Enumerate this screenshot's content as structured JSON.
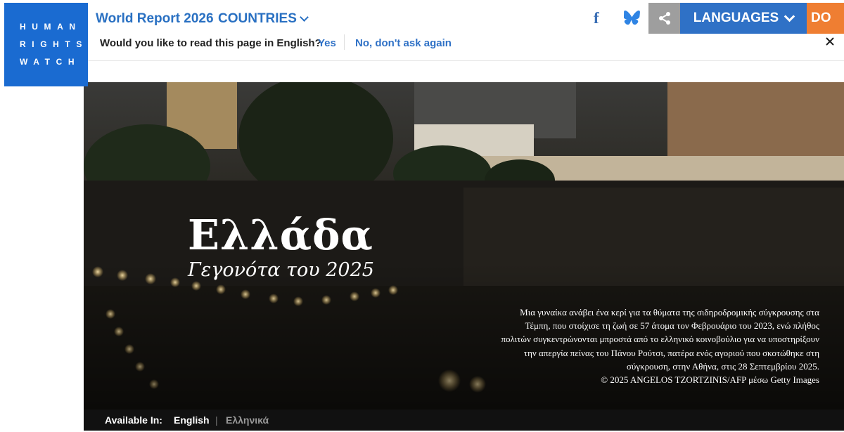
{
  "logo": {
    "lines": [
      "HUMAN",
      "RIGHTS",
      "WATCH"
    ]
  },
  "header": {
    "site_title": "World Report 2026",
    "countries_label": "COUNTRIES",
    "languages_label": "LANGUAGES",
    "donate_label": "DO",
    "icons": [
      "facebook-icon",
      "bluesky-icon",
      "share-icon",
      "chevron-down-icon"
    ]
  },
  "translate_prompt": {
    "question": "Would you like to read this page in English?",
    "yes": "Yes",
    "no": "No, don't ask again"
  },
  "hero": {
    "title": "Ελλάδα",
    "subtitle": "Γεγονότα του 2025",
    "caption": "Μια γυναίκα ανάβει ένα κερί για τα θύματα της σιδηροδρομικής σύγκρουσης στα Τέμπη, που στοίχισε τη ζωή σε 57 άτομα τον Φεβρουάριο του 2023, ενώ πλήθος πολιτών συγκεντρώνονται μπροστά από το ελληνικό κοινοβούλιο για να υποστηρίξουν την απεργία πείνας του Πάνου Ρούτσι, πατέρα ενός αγοριού που σκοτώθηκε στη σύγκρουση, στην Αθήνα, στις 28 Σεπτεμβρίου 2025.",
    "credit": "© 2025 ANGELOS TZORTZINIS/AFP μέσω Getty Images"
  },
  "available_in": {
    "label": "Available In:",
    "languages": [
      "English",
      "Ελληνικά"
    ],
    "separator": "|"
  },
  "colors": {
    "brand_blue": "#1a6bd1",
    "link_blue": "#2f71c6",
    "donate_orange": "#ef7e32",
    "share_gray": "#9e9e9e"
  }
}
